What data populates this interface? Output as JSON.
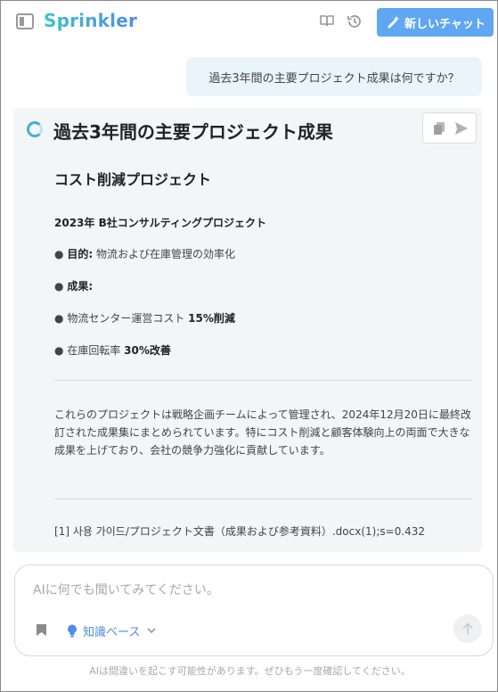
{
  "header": {
    "brand": "Sprinkler",
    "new_chat_label": "新しいチャット"
  },
  "conversation": {
    "user_message": "過去3年間の主要プロジェクト成果は何ですか？",
    "answer": {
      "title": "過去3年間の主要プロジェクト成果",
      "section_heading": "コスト削減プロジェクト",
      "project_name": "2023年 B社コンサルティングプロジェクト",
      "bullets": [
        {
          "label": "目的",
          "sep": ":",
          "text": " 物流および在庫管理の効率化",
          "emph": ""
        },
        {
          "label": "成果",
          "sep": ":",
          "text": "",
          "emph": ""
        },
        {
          "label": "",
          "sep": "",
          "text": "物流センター運営コスト ",
          "emph": "15%削減"
        },
        {
          "label": "",
          "sep": "",
          "text": "在庫回転率 ",
          "emph": "30%改善"
        }
      ],
      "bullet_symbol": "●",
      "summary": "これらのプロジェクトは戦略企画チームによって管理され、2024年12月20日に最終改訂された成果集にまとめられています。特にコスト削減と顧客体験向上の両面で大きな成果を上げており、会社の競争力強化に貢献しています。",
      "citation": "[1] 사용 가이드/プロジェクト文書（成果および参考資料）.docx(1);s=0.432"
    }
  },
  "composer": {
    "placeholder": "AIに何でも聞いてみてください。",
    "knowledge_base_label": "知識ベース"
  },
  "footer": {
    "disclaimer": "AIは間違いを起こす可能性があります。ぜひもう一度確認してください。"
  },
  "colors": {
    "accent": "#5fa6f3",
    "link": "#4f8be8",
    "user_bubble": "#eaf4fb",
    "answer_card": "#f4f5f6"
  },
  "icons": [
    "sidebar-toggle-icon",
    "book-icon",
    "history-icon",
    "new-chat-icon",
    "spinner-icon",
    "copy-icon",
    "send-icon",
    "bookmark-icon",
    "lightbulb-icon",
    "chevron-down-icon",
    "arrow-up-icon"
  ]
}
